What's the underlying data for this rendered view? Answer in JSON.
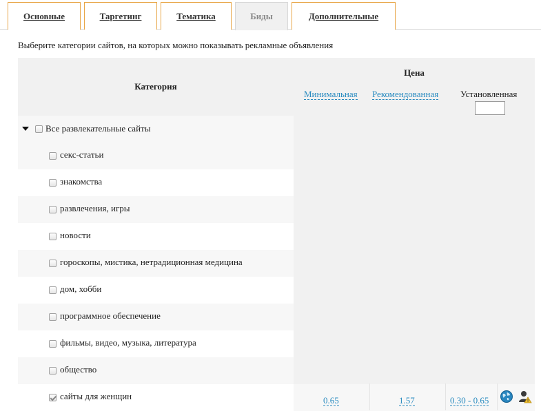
{
  "tabs": [
    {
      "label": "Основные"
    },
    {
      "label": "Таргетинг"
    },
    {
      "label": "Тематика"
    },
    {
      "label": "Биды"
    },
    {
      "label": "Дополнительные"
    }
  ],
  "intro_text": "Выберите категории сайтов, на которых можно показывать рекламные объявления",
  "table": {
    "header_category": "Категория",
    "header_price": "Цена",
    "header_min": "Минимальная",
    "header_recommended": "Рекомендованная",
    "header_set": "Установленная"
  },
  "parent_category": {
    "label": "Все развлекательные сайты",
    "checked": false
  },
  "categories": [
    {
      "label": "секс-статьи",
      "checked": false
    },
    {
      "label": "знакомства",
      "checked": false
    },
    {
      "label": "развлечения, игры",
      "checked": false
    },
    {
      "label": "новости",
      "checked": false
    },
    {
      "label": "гороскопы, мистика, нетрадиционная медицина",
      "checked": false
    },
    {
      "label": "дом, хобби",
      "checked": false
    },
    {
      "label": "программное обеспечение",
      "checked": false
    },
    {
      "label": "фильмы, видео, музыка, литература",
      "checked": false
    },
    {
      "label": "общество",
      "checked": false
    },
    {
      "label": "сайты для женщин",
      "checked": true
    }
  ],
  "selected_row": {
    "min": "0.65",
    "recommended": "1.57",
    "set_range": "0.30 - 0.65"
  },
  "colors": {
    "tab_border": "#e8a648",
    "link": "#2a8bc0"
  }
}
